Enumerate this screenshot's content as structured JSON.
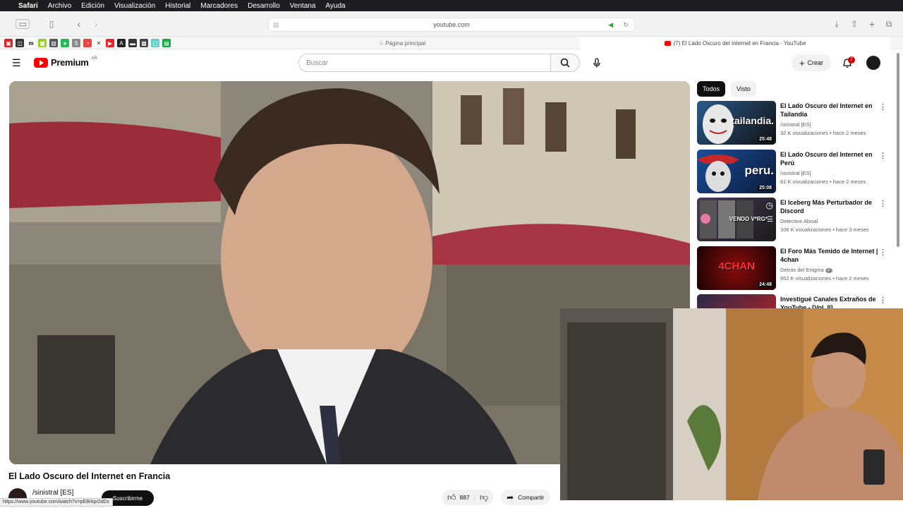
{
  "menubar": {
    "app": "Safari",
    "items": [
      "Archivo",
      "Edición",
      "Visualización",
      "Historial",
      "Marcadores",
      "Desarrollo",
      "Ventana",
      "Ayuda"
    ]
  },
  "toolbar": {
    "url": "youtube.com"
  },
  "favbar": {
    "home_tab": "Página principal",
    "active_tab": "(7) El Lado Oscuro del Internet en Francia - YouTube"
  },
  "header": {
    "logo": "Premium",
    "logo_sup": "AR",
    "search_placeholder": "Buscar",
    "create_label": "Crear",
    "notif_count": "7"
  },
  "video": {
    "title": "El Lado Oscuro del Internet en Francia",
    "channel": "/sinistral [ES]",
    "subscribe": "Suscribirme",
    "likes": "887",
    "share": "Compartir"
  },
  "statusbar": {
    "url": "https://www.youtube.com/watch?v=pEBrkpr2dDc"
  },
  "chips": [
    "Todos",
    "Visto"
  ],
  "recommendations": [
    {
      "title": "El Lado Oscuro del Internet en Tailandia",
      "channel": "/sinistral [ES]",
      "meta": "32 K visualizaciones • hace 2 meses",
      "duration": "25:48",
      "thumb_text": "tailandia."
    },
    {
      "title": "El Lado Oscuro del Internet en Perú",
      "channel": "/sinistral [ES]",
      "meta": "81 K visualizaciones • hace 2 meses",
      "duration": "25:08",
      "thumb_text": "peru."
    },
    {
      "title": "El Iceberg Más Perturbador de Discord",
      "channel": "Detective Abisal",
      "meta": "106 K visualizaciones • hace 3 meses",
      "duration": "",
      "thumb_text": "VENDO V*RG*"
    },
    {
      "title": "El Foro Más Temido de Internet | 4chan",
      "channel": "Detrás del Enigma",
      "meta": "952 K visualizaciones • hace 2 meses",
      "duration": "24:48",
      "thumb_text": "4CHAN"
    },
    {
      "title": "Investigué Canales Extraños de YouTube - [Vol. II]",
      "channel": "",
      "meta": "",
      "duration": "",
      "thumb_text": ""
    }
  ]
}
